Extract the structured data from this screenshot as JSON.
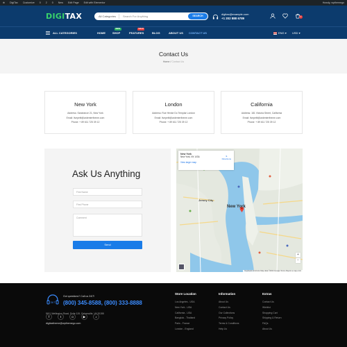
{
  "admin_bar": {
    "items": [
      "DigiTax",
      "Customize",
      "0",
      "2",
      "0",
      "New",
      "Edit Page",
      "Edit with Elementor"
    ],
    "user": "Howdy, wpthemego"
  },
  "header": {
    "logo_main": "D",
    "logo_accent": "IGI",
    "logo_rest": "TAX",
    "search": {
      "category": "All Categories",
      "placeholder": "Search For Anything",
      "button": "SEARCH"
    },
    "email": "digitax@example.com",
    "phone": "+1 202 888 6789",
    "cart_count": "0"
  },
  "nav": {
    "all_categories": "ALL CATEGORIES",
    "items": [
      {
        "label": "HOME"
      },
      {
        "label": "SHOP",
        "badge": "NEW"
      },
      {
        "label": "FEATURES",
        "badge": "SALE"
      },
      {
        "label": "BLOG"
      },
      {
        "label": "ABOUT US"
      },
      {
        "label": "CONTACT US"
      }
    ],
    "language": "ENG",
    "currency": "USD"
  },
  "page": {
    "title": "Contact Us",
    "breadcrumb_home": "Home",
    "breadcrumb_sep": " / ",
    "breadcrumb_current": "Contact Us"
  },
  "locations": [
    {
      "city": "New York",
      "address": "Address: Sandrance 21, New York",
      "email": "Email: livepetit@ardentertheme.com",
      "phone": "Phone: + 89 611 725 39 12"
    },
    {
      "city": "London",
      "address": "Address: Rue Henke Do Templar London",
      "email": "Email: livepetit@ardentertheme.com",
      "phone": "Phone: + 89 611 725 39 12"
    },
    {
      "city": "California",
      "address": "Address: 181 Victoria Street, California",
      "email": "Email: livepetit@ardentertheme.com",
      "phone": "Phone: + 89 611 725 39 12"
    }
  ],
  "form": {
    "title": "Ask Us Anything",
    "first_name": "First Name",
    "first_phone": "First Phone",
    "comment": "Comment",
    "send": "Send"
  },
  "map": {
    "place": "New York",
    "place_sub": "New York, NY, USA",
    "link": "View larger map",
    "directions": "Directions",
    "city_label": "New York",
    "label_jersey": "Jersey City",
    "attribution": "Keyboard shortcuts  Map data ©2024 Google  Terms  Report a map error"
  },
  "footer": {
    "hotline_label": "Got questions? Call us 24/7!",
    "hotline": "(800) 345-8588, (800) 333-8888",
    "address": "9611 Wellington Road, Suite 119, Gainesville, VA 20155",
    "email": "digitaxtheme@wpthemego.com",
    "social": [
      "f",
      "t",
      "o",
      "▶",
      "♪"
    ],
    "columns": [
      {
        "title": "Store Location",
        "items": [
          "Los Angeles - USA",
          "New York - USA",
          "California - USA",
          "Bangkok - Thailand",
          "Paris - France",
          "London - England"
        ]
      },
      {
        "title": "Information",
        "items": [
          "About Us",
          "Contact Us",
          "Our Collections",
          "Privacy Policy",
          "Terms & Conditions",
          "Help Us"
        ]
      },
      {
        "title": "Extras",
        "items": [
          "Contact Us",
          "Wishlist",
          "Shopping Cart",
          "Shipping & Return",
          "FAQs",
          "About Us"
        ]
      }
    ]
  },
  "colors": {
    "header": "#0c3b6d",
    "accent": "#1a7ce8",
    "logo_green": "#39d36a",
    "footer": "#0a0a0a"
  }
}
